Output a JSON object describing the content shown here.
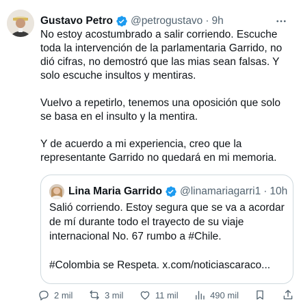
{
  "author": {
    "name": "Gustavo Petro",
    "handle": "@petrogustavo",
    "time": "9h"
  },
  "tweet": {
    "paragraphs": [
      "No estoy acostumbrado a salir corriendo. Escuche toda la intervención de la parlamentaria Garrido, no dió cifras, no demostró que las mias sean falsas. Y solo escuche insultos y mentiras.",
      "Vuelvo a repetirlo, tenemos una oposición que solo se basa en el insulto y la mentira.",
      "Y de acuerdo a mi experiencia, creo que la representante Garrido no quedará en mi memoria."
    ]
  },
  "quote": {
    "name": "Lina Maria Garrido",
    "handle": "@linamariagarri1",
    "time": "10h",
    "paragraphs": [
      "Salió corriendo. Estoy segura que se va a acordar de mí durante todo el trayecto de su viaje internacional No. 67 rumbo a #Chile.",
      "#Colombia se Respeta. x.com/noticiascaraco..."
    ]
  },
  "actions": {
    "replies": "2 mil",
    "reposts": "3 mil",
    "likes": "11 mil",
    "views": "490 mil"
  },
  "colors": {
    "verified": "#1d9bf0",
    "muted": "#536471",
    "text": "#0f1419",
    "border": "#cfd9de"
  }
}
